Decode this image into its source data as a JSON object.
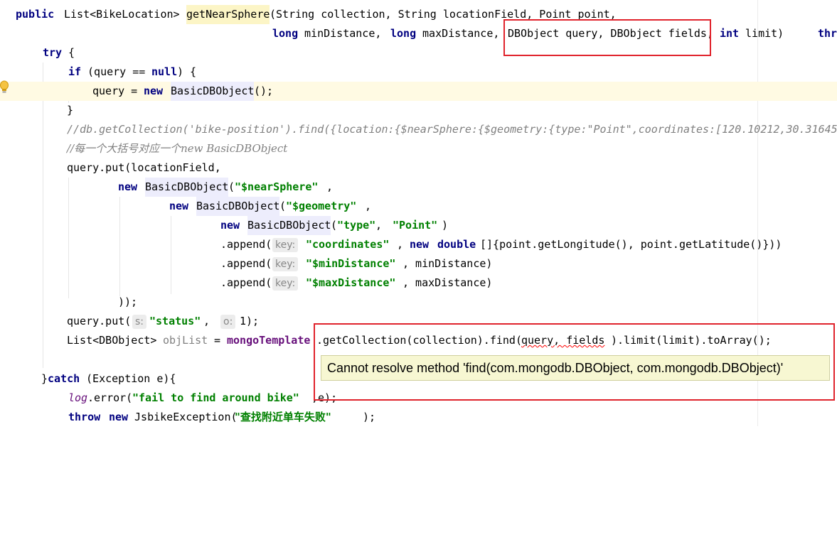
{
  "code": {
    "l1": {
      "public": "public",
      "ret": "List<BikeLocation>",
      "method": "getNearSphere",
      "params": "(String collection, String locationField, Point point,"
    },
    "l2": {
      "long1": "long",
      "minDistance": " minDistance, ",
      "long2": "long",
      "maxDistance": " maxDistance, ",
      "dbquery": "DBObject query, DBObject fields,",
      "int": "int",
      "limit": " limit)",
      "throws": "thr"
    },
    "l3": {
      "try": "try",
      "brace": " {"
    },
    "l4": {
      "if": "if",
      "cond": " (query == ",
      "null": "null",
      "rest": ") {"
    },
    "l5": {
      "query": "query = ",
      "new": "new",
      "cls": "BasicDBObject",
      "end": "();"
    },
    "l6": {
      "brace": "}"
    },
    "l7": {
      "comment": "//db.getCollection('bike-position').find({location:{$nearSphere:{$geometry:{type:\"Point\",coordinates:[120.10212,30.31645"
    },
    "l8": {
      "comment": "//每一个大括号对应一个new BasicDBObject"
    },
    "l9": {
      "text": "query.put(locationField,"
    },
    "l10": {
      "new": "new",
      "cls": "BasicDBObject",
      "open": "(",
      "str": "\"$nearSphere\"",
      "comma": ","
    },
    "l11": {
      "new": "new",
      "cls": "BasicDBObject",
      "open": "(",
      "str": "\"$geometry\"",
      "comma": ","
    },
    "l12": {
      "new": "new",
      "cls": "BasicDBObject",
      "open": "(",
      "str1": "\"type\"",
      "sep": ", ",
      "str2": "\"Point\"",
      "close": ")"
    },
    "l13": {
      "append": ".append(",
      "hint": "key:",
      "str": "\"coordinates\"",
      "sep": ", ",
      "new": "new",
      "double": "double",
      "rest": "[]{point.getLongitude(), point.getLatitude()}))"
    },
    "l14": {
      "append": ".append(",
      "hint": "key:",
      "str": "\"$minDistance\"",
      "rest": ", minDistance)"
    },
    "l15": {
      "append": ".append(",
      "hint": "key:",
      "str": "\"$maxDistance\"",
      "rest": ", maxDistance)"
    },
    "l16": {
      "text": "));"
    },
    "l17": {
      "put": "query.put(",
      "hint1": "s:",
      "str": "\"status\"",
      "sep": ",  ",
      "hint2": "o:",
      "rest": "1);"
    },
    "l18": {
      "list": "List<DBObject> ",
      "var": "objList",
      "eq": " = ",
      "field": "mongoTemplate",
      "mid": ".getCollection(collection).find(",
      "args": "query, fields",
      "tail": ").limit(limit).toArray();"
    },
    "l20": {
      "brace": "}",
      "catch": "catch",
      "rest": " (Exception e){"
    },
    "l21": {
      "log": "log",
      "mid": ".error(",
      "str": "\"fail to find around bike\"",
      "rest": ",e);"
    },
    "l22": {
      "throw": "throw",
      "sp": " ",
      "new": "new",
      "rest": " JsbikeException(",
      "str": "\"查找附近单车失败\"",
      "end": ");"
    }
  },
  "tooltip": {
    "message": "Cannot resolve method 'find(com.mongodb.DBObject, com.mongodb.DBObject)'"
  },
  "colors": {
    "keyword": "#000080",
    "string": "#008000",
    "comment": "#808080",
    "annotation_box": "#e0232c",
    "tooltip_bg": "#f7f7d2"
  }
}
